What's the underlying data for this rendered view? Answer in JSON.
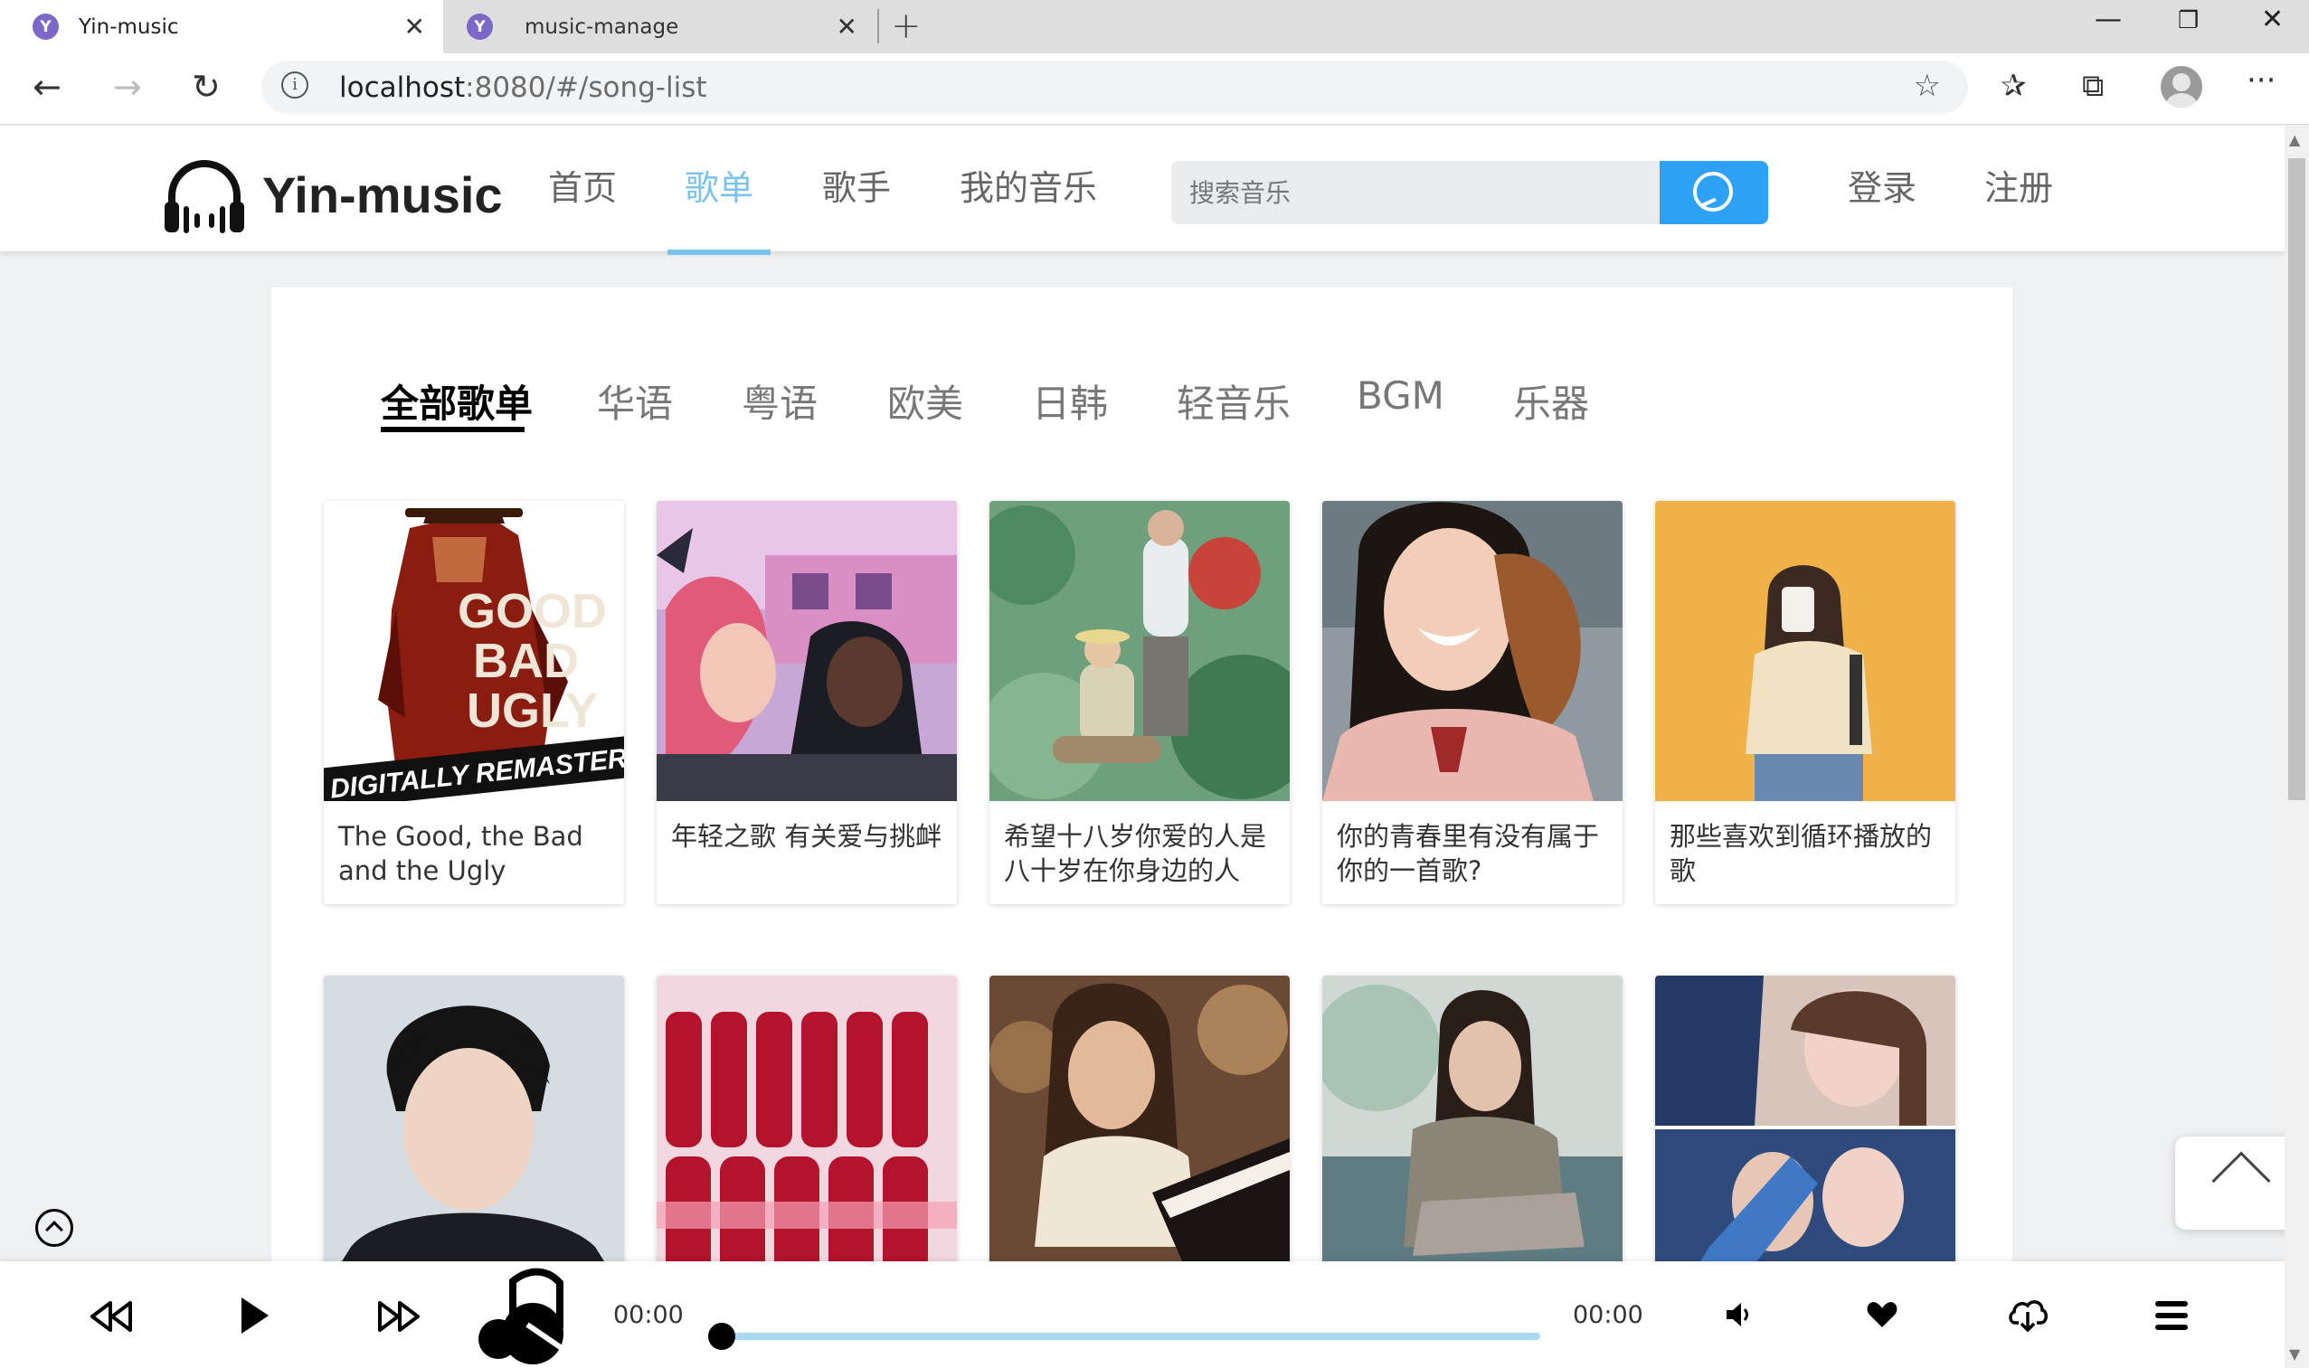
{
  "browser": {
    "tabs": [
      {
        "title": "Yin-music",
        "active": true
      },
      {
        "title": "music-manage",
        "active": false
      }
    ],
    "url_host": "localhost",
    "url_path": ":8080/#/song-list",
    "favicon_letter": "Y"
  },
  "site": {
    "logo_text": "Yin-music",
    "nav": [
      "首页",
      "歌单",
      "歌手",
      "我的音乐"
    ],
    "active_nav": "歌单",
    "search_placeholder": "搜索音乐",
    "login": "登录",
    "register": "注册",
    "accent_color": "#7cc2ee",
    "search_button_color": "#2ea1f5"
  },
  "categories": [
    "全部歌单",
    "华语",
    "粤语",
    "欧美",
    "日韩",
    "轻音乐",
    "BGM",
    "乐器"
  ],
  "active_category": "全部歌单",
  "playlists": [
    {
      "title": "The Good, the Bad and the Ugly",
      "cover_text": "DIGITALLY REMASTERED",
      "cover": "movie-poster"
    },
    {
      "title": "年轻之歌 有关爱与挑衅",
      "cover": "anime-couple"
    },
    {
      "title": "希望十八岁你爱的人是八十岁在你身边的人",
      "cover": "garden-illustration"
    },
    {
      "title": "你的青春里有没有属于你的一首歌?",
      "cover": "smiling-girl"
    },
    {
      "title": "那些喜欢到循环播放的歌",
      "cover": "girl-yellow-wall"
    },
    {
      "title": "",
      "cover": "male-singer"
    },
    {
      "title": "",
      "cover": "soda-bottles"
    },
    {
      "title": "",
      "cover": "girl-piano"
    },
    {
      "title": "",
      "cover": "girl-sitting"
    },
    {
      "title": "",
      "cover": "drama-couple"
    }
  ],
  "player": {
    "current_time": "00:00",
    "total_time": "00:00",
    "progress": 0
  }
}
